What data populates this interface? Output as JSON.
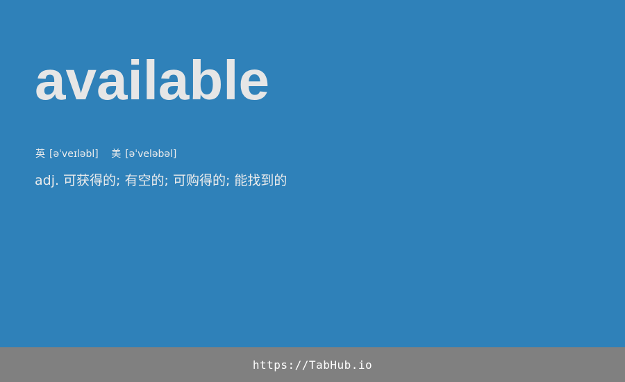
{
  "card": {
    "word": "available",
    "phonetics": {
      "uk_label": "英",
      "uk_ipa": "[əˈveɪləbl]",
      "us_label": "美",
      "us_ipa": "[əˈveləbəl]"
    },
    "definition": "adj. 可获得的; 有空的; 可购得的; 能找到的"
  },
  "footer": {
    "link_text": "https://TabHub.io"
  },
  "colors": {
    "background": "#2f81b9",
    "footer_background": "#808080",
    "word_text": "#e6e6e6"
  }
}
